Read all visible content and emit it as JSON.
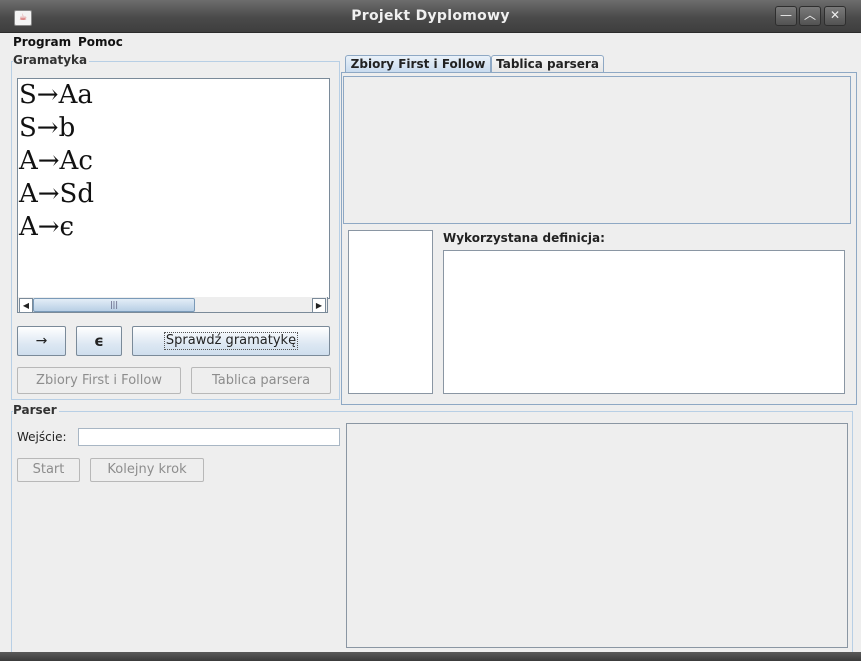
{
  "window": {
    "title": "Projekt Dyplomowy",
    "app_icon_glyph": "☕",
    "controls": {
      "minimize": "—",
      "maximize": "︿",
      "close": "✕"
    }
  },
  "menu": {
    "items": [
      "Program",
      "Pomoc"
    ]
  },
  "grammar": {
    "title": "Gramatyka",
    "rules": [
      "S→Aa",
      "S→b",
      "A→Ac",
      "A→Sd",
      "A→ϵ"
    ],
    "scroll": {
      "left_arrow": "◀",
      "right_arrow": "▶",
      "thumb_grip": "|||"
    },
    "buttons": {
      "arrow": "→",
      "epsilon": "ϵ",
      "check": "Sprawdź gramatykę",
      "first_follow": "Zbiory First i Follow",
      "parser_table": "Tablica parsera"
    }
  },
  "tabs": {
    "first_follow": "Zbiory First i Follow",
    "parser_table": "Tablica parsera",
    "active": "first_follow"
  },
  "definition": {
    "label": "Wykorzystana definicja:"
  },
  "parser": {
    "title": "Parser",
    "input_label": "Wejście:",
    "input_value": "",
    "buttons": {
      "start": "Start",
      "next_step": "Kolejny krok"
    }
  },
  "colors": {
    "border_accent": "#b8cfe5",
    "button_gradient_end": "#cfdeed",
    "title_bar": "#4a4a4a"
  }
}
